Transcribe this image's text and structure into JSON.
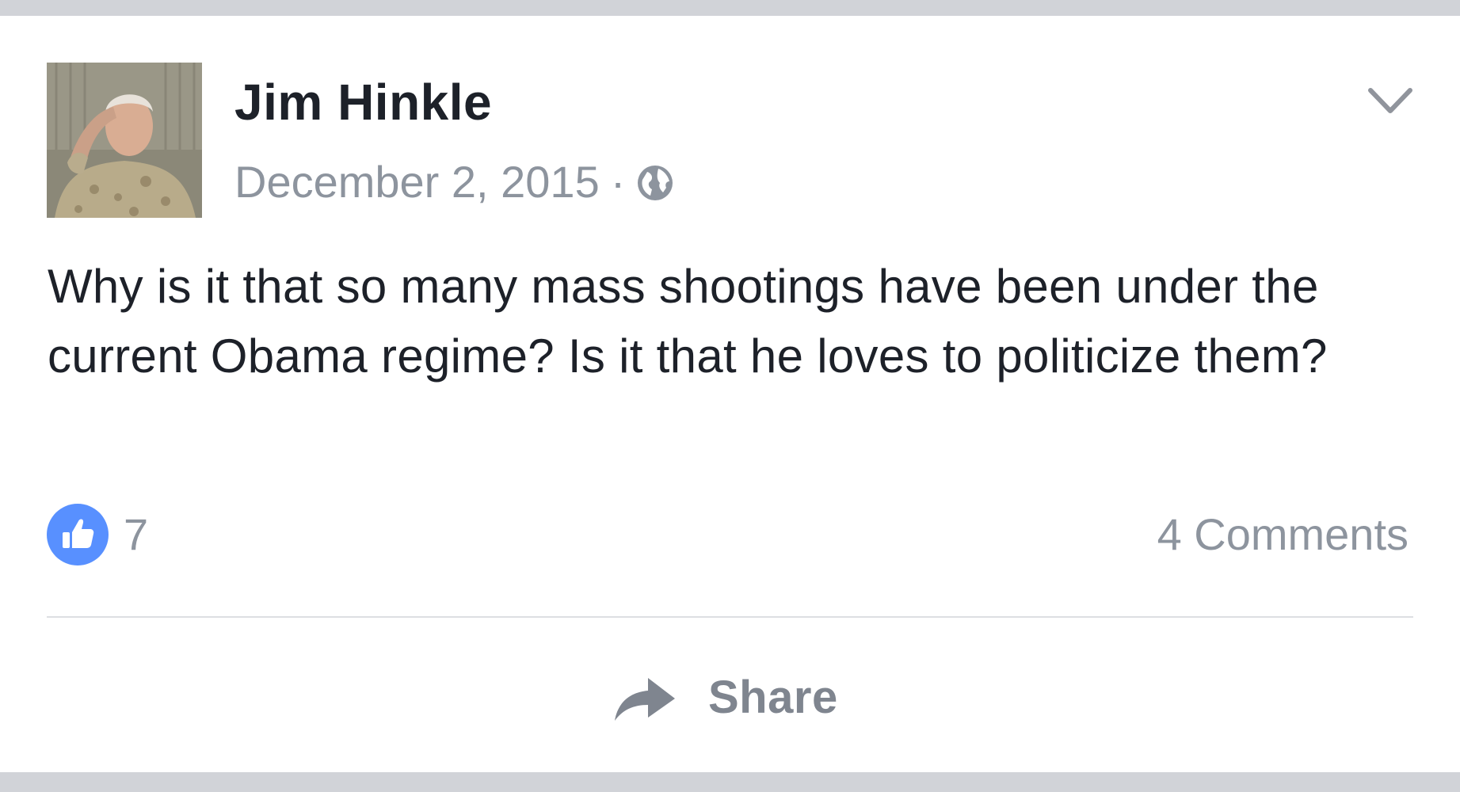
{
  "post": {
    "author": {
      "name": "Jim Hinkle",
      "avatar": "profile-photo"
    },
    "date": "December 2, 2015",
    "separator": "·",
    "privacy_icon": "globe-icon",
    "menu_icon": "chevron-down-icon",
    "text": "Why is it that so many mass shootings have been under the current Obama regime? Is it that he loves to politicize them?"
  },
  "reactions": {
    "like_icon": "thumbs-up-icon",
    "like_count": "7",
    "comments_label": "4 Comments"
  },
  "actions": {
    "share_icon": "share-arrow-icon",
    "share_label": "Share"
  },
  "colors": {
    "background": "#ffffff",
    "frame_bar": "#d1d3d8",
    "text_primary": "#1d2129",
    "text_secondary": "#8d949e",
    "like_blue": "#5890ff",
    "divider": "#dddfe2"
  }
}
